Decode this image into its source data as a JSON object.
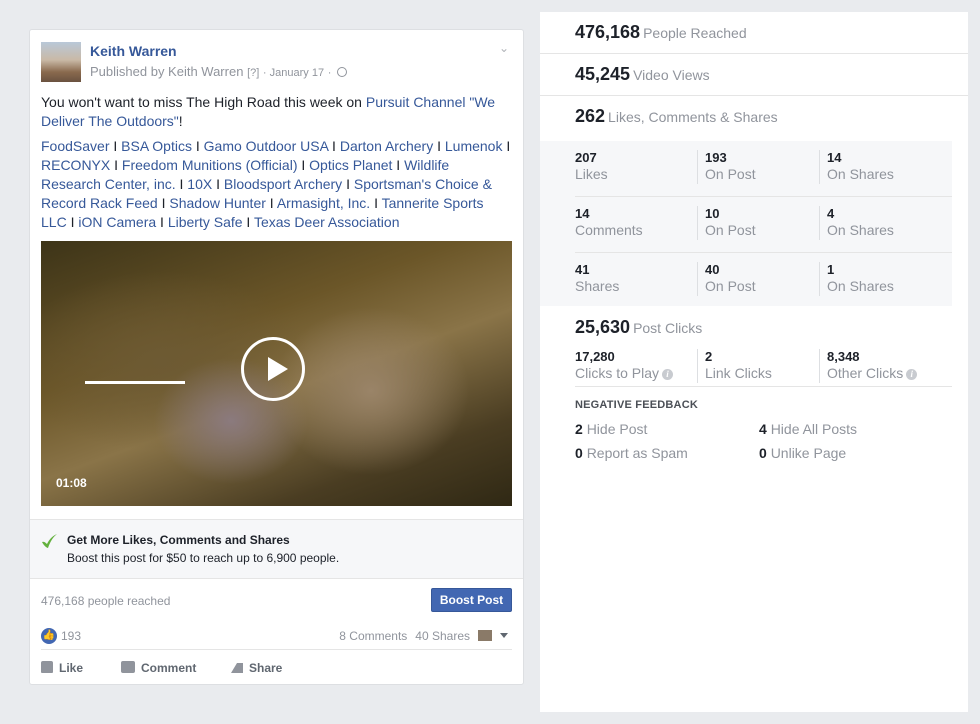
{
  "post": {
    "author": "Keith Warren",
    "published_by": "Published by Keith Warren",
    "help_marker": "[?]",
    "date": "January 17",
    "text_prefix": "You won't want to miss The High Road this week on ",
    "text_link": "Pursuit Channel \"We Deliver The Outdoors\"",
    "text_suffix": "!",
    "tags": [
      "FoodSaver",
      "BSA Optics",
      "Gamo Outdoor USA",
      "Darton Archery",
      "Lumenok",
      "RECONYX",
      "Freedom Munitions (Official)",
      "Optics Planet",
      "Wildlife Research Center, inc.",
      "10X",
      "Bloodsport Archery",
      "Sportsman's Choice & Record Rack Feed",
      "Shadow Hunter",
      "Armasight, Inc.",
      "Tannerite Sports LLC",
      "iON Camera",
      "Liberty Safe",
      "Texas Deer Association"
    ],
    "tag_separator": " I ",
    "video": {
      "duration": "01:08",
      "progress": 0
    },
    "boost_promo": {
      "title": "Get More Likes, Comments and Shares",
      "description": "Boost this post for $50 to reach up to 6,900 people."
    },
    "reach_text": "476,168 people reached",
    "boost_button": "Boost Post",
    "like_count": "193",
    "comments": "8 Comments",
    "shares": "40 Shares",
    "actions": {
      "like": "Like",
      "comment": "Comment",
      "share": "Share"
    },
    "accent_color": "#4267b2",
    "link_color": "#365899"
  },
  "insights": {
    "people_reached": {
      "value": "476,168",
      "label": "People Reached"
    },
    "video_views": {
      "value": "45,245",
      "label": "Video Views"
    },
    "engagement": {
      "value": "262",
      "label": "Likes, Comments & Shares"
    },
    "grid": [
      [
        {
          "value": "207",
          "label": "Likes"
        },
        {
          "value": "193",
          "label": "On Post"
        },
        {
          "value": "14",
          "label": "On Shares"
        }
      ],
      [
        {
          "value": "14",
          "label": "Comments"
        },
        {
          "value": "10",
          "label": "On Post"
        },
        {
          "value": "4",
          "label": "On Shares"
        }
      ],
      [
        {
          "value": "41",
          "label": "Shares"
        },
        {
          "value": "40",
          "label": "On Post"
        },
        {
          "value": "1",
          "label": "On Shares"
        }
      ]
    ],
    "post_clicks": {
      "value": "25,630",
      "label": "Post Clicks"
    },
    "clicks": [
      {
        "value": "17,280",
        "label": "Clicks to Play"
      },
      {
        "value": "2",
        "label": "Link Clicks"
      },
      {
        "value": "8,348",
        "label": "Other Clicks"
      }
    ],
    "negative_feedback": {
      "title": "NEGATIVE FEEDBACK",
      "items": [
        {
          "value": "2",
          "label": "Hide Post"
        },
        {
          "value": "4",
          "label": "Hide All Posts"
        },
        {
          "value": "0",
          "label": "Report as Spam"
        },
        {
          "value": "0",
          "label": "Unlike Page"
        }
      ]
    }
  }
}
